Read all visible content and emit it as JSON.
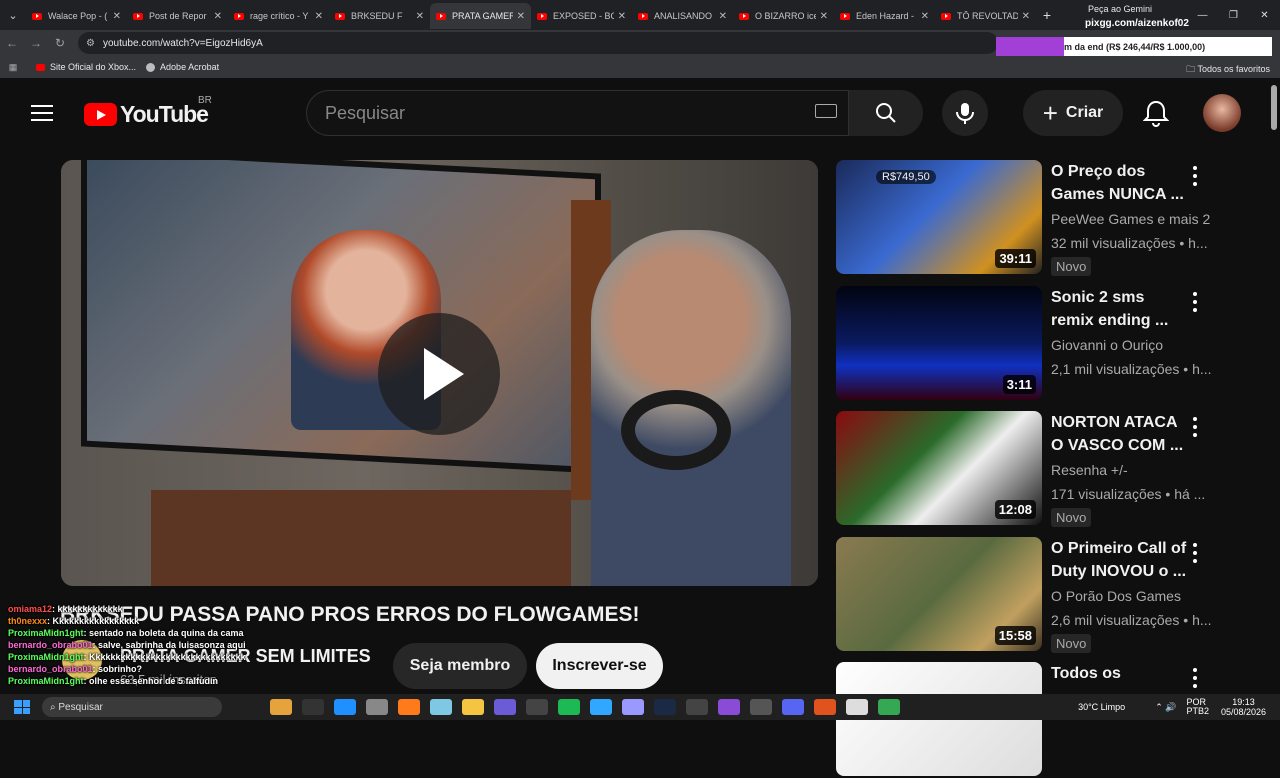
{
  "browser": {
    "tabs": [
      {
        "title": "Walace Pop - (",
        "active": false
      },
      {
        "title": "Post de Repor",
        "active": false
      },
      {
        "title": "rage crítico - Y",
        "active": false
      },
      {
        "title": "BRKSEDU F",
        "active": false
      },
      {
        "title": "PRATA GAMER",
        "active": true
      },
      {
        "title": "EXPOSED - BC",
        "active": false
      },
      {
        "title": "ANALISANDO",
        "active": false
      },
      {
        "title": "O BIZARRO ice",
        "active": false
      },
      {
        "title": "Eden Hazard -",
        "active": false
      },
      {
        "title": "TÔ REVOLTAD(",
        "active": false
      }
    ],
    "gemini_label": "Peça ao Gemini",
    "url": "youtube.com/watch?v=EigozHid6yA",
    "bookmarks": [
      "Site Oficial do Xbox...",
      "Adobe Acrobat"
    ],
    "all_bookmarks": "Todos os favoritos"
  },
  "stream_overlay": {
    "pix_user": "pixgg.com/aizenkof02",
    "goal_text": "m da end (R$ 246,44/R$ 1.000,00)",
    "goal_progress": 0.2464
  },
  "youtube": {
    "logo_text": "YouTube",
    "region": "BR",
    "search_placeholder": "Pesquisar",
    "create_label": "Criar"
  },
  "video": {
    "title": "BRKSEDU PASSA PANO PROS ERROS DO FLOWGAMES!",
    "channel": "PRATA GAMER SEM LIMITES",
    "subscribers": "63,5 mil inscritos",
    "member_label": "Seja membro",
    "subscribe_label": "Inscrever-se"
  },
  "recommendations": [
    {
      "title": "O Preço dos Games NUNCA ...",
      "channel": "PeeWee Games e mais 2",
      "views": "32 mil visualizações • h...",
      "badge": "Novo",
      "duration": "39:11",
      "price_tag": "R$749,50"
    },
    {
      "title": "Sonic 2 sms remix ending ...",
      "channel": "Giovanni o Ouriço",
      "views": "2,1 mil visualizações • h...",
      "badge": "",
      "duration": "3:11"
    },
    {
      "title": "NORTON ATACA O VASCO COM ...",
      "channel": "Resenha +/-",
      "views": "171 visualizações • há ...",
      "badge": "Novo",
      "duration": "12:08"
    },
    {
      "title": "O Primeiro Call of Duty INOVOU o ...",
      "channel": "O Porão Dos Games",
      "views": "2,6 mil visualizações • h...",
      "badge": "Novo",
      "duration": "15:58"
    },
    {
      "title": "Todos os",
      "channel": "",
      "views": "",
      "badge": "",
      "duration": ""
    }
  ],
  "chat": [
    {
      "user": "omiama12",
      "msg": ": kkkkkkkkkkkkk",
      "color": "#ff4d4d"
    },
    {
      "user": "th0nexxx",
      "msg": ": Kkkkkkkkkkkkkkkkk",
      "color": "#ff8c1a"
    },
    {
      "user": "ProximaMidn1ght",
      "msg": ": sentado na boleta da quina da cama",
      "color": "#5cff5c"
    },
    {
      "user": "bernardo_obrabo01",
      "msg": ": salve, sabrinha da luisasonza aqui",
      "color": "#ff6ad5"
    },
    {
      "user": "ProximaMidn1ght",
      "msg": ": Kkkkkkkkkkkkkkkkkkkkkkkkkkkkkkk",
      "color": "#5cff5c"
    },
    {
      "user": "bernardo_obrabo01",
      "msg": ": sobrinho?",
      "color": "#ff6ad5"
    },
    {
      "user": "ProximaMidn1ght",
      "msg": ": olhe esse senhor de 5 falfudin",
      "color": "#5cff5c"
    }
  ],
  "taskbar": {
    "search_label": "Pesquisar",
    "weather": "30°C  Limpo",
    "lang_top": "POR",
    "lang_bottom": "PTB2",
    "time": "19:13",
    "date": "05/08/2026"
  }
}
